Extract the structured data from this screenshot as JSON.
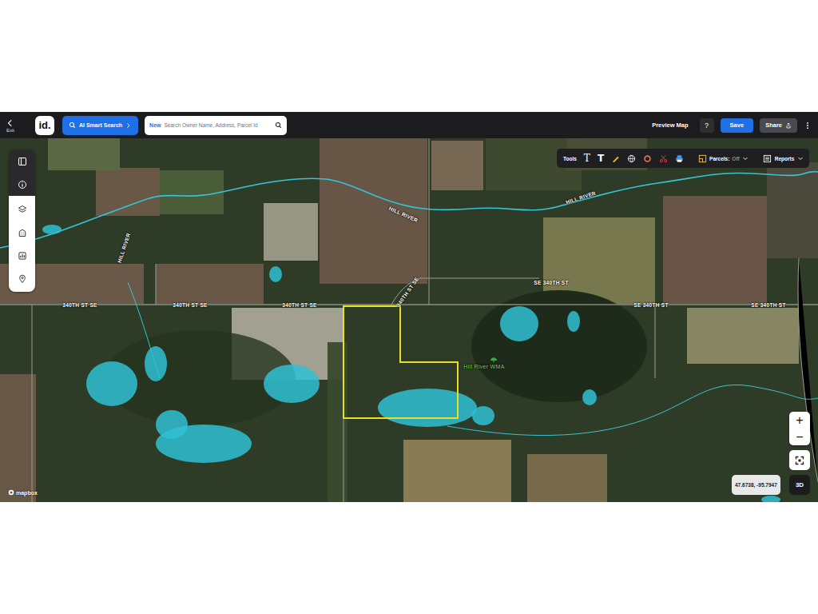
{
  "toolbar": {
    "back_label": "Exit",
    "logo": "id.",
    "ai_search": "AI Smart Search",
    "search": {
      "badge": "New",
      "placeholder": "Search Owner Name, Address, Parcel Id"
    },
    "preview": "Preview Map",
    "help": "?",
    "save": "Save",
    "share": "Share"
  },
  "tools": {
    "label": "Tools",
    "glyphs": [
      "T",
      "T"
    ],
    "parcels_label": "Parcels:",
    "parcels_state": "Off",
    "reports": "Reports"
  },
  "map": {
    "labels": [
      "HILL RIVER",
      "HILL RIVER",
      "HILL RIVER",
      "340TH ST SE",
      "340TH ST SE",
      "340TH ST SE",
      "340TH ST SE",
      "SE 340TH ST",
      "SE 340TH ST",
      "SE 340TH ST",
      "Hill River WMA"
    ],
    "coordinates": "47.6738, -95.7947",
    "zoom_in": "+",
    "zoom_out": "−",
    "view_3d": "3D",
    "attribution": "mapbox"
  }
}
